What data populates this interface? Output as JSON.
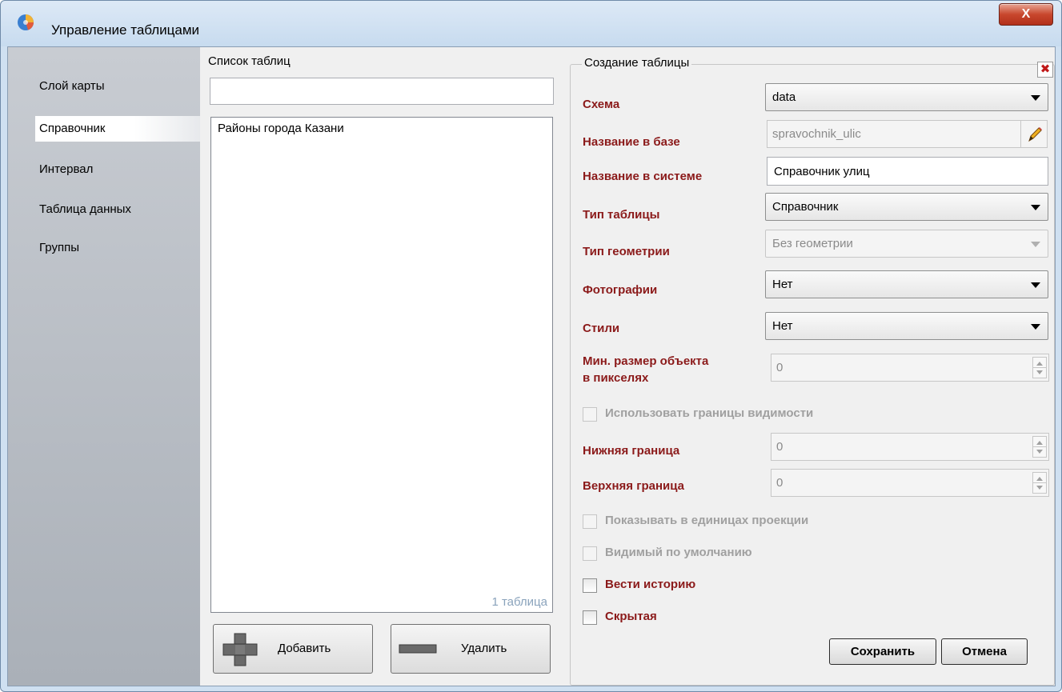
{
  "window": {
    "title": "Управление таблицами",
    "close_glyph": "X"
  },
  "sidebar": {
    "items": [
      {
        "label": "Слой карты"
      },
      {
        "label": "Справочник"
      },
      {
        "label": "Интервал"
      },
      {
        "label": "Таблица данных"
      },
      {
        "label": "Группы"
      }
    ],
    "selected": "Справочник"
  },
  "table_list": {
    "title": "Список таблиц",
    "search_value": "",
    "items": [
      "Районы города Казани"
    ],
    "count_label": "1 таблица",
    "add_label": "Добавить",
    "delete_label": "Удалить"
  },
  "create_table": {
    "title": "Создание таблицы",
    "close_glyph": "✖",
    "schema": {
      "label": "Схема",
      "value": "data"
    },
    "db_name": {
      "label": "Название в базе",
      "value": "spravochnik_ulic"
    },
    "system_name": {
      "label": "Название в системе",
      "value": "Справочник улиц"
    },
    "table_type": {
      "label": "Тип таблицы",
      "value": "Справочник"
    },
    "geometry_type": {
      "label": "Тип геометрии",
      "value": "Без геометрии"
    },
    "photos": {
      "label": "Фотографии",
      "value": "Нет"
    },
    "styles": {
      "label": "Стили",
      "value": "Нет"
    },
    "min_size": {
      "label_line1": "Мин. размер объекта",
      "label_line2": "в пикселях",
      "value": "0"
    },
    "use_visibility": {
      "label": "Использовать границы видимости",
      "checked": false
    },
    "lower_bound": {
      "label": "Нижняя граница",
      "value": "0"
    },
    "upper_bound": {
      "label": "Верхняя граница",
      "value": "0"
    },
    "projection_units": {
      "label": "Показывать в единицах проекции",
      "checked": false
    },
    "visible_default": {
      "label": "Видимый по умолчанию",
      "checked": false
    },
    "keep_history": {
      "label": "Вести историю",
      "checked": false
    },
    "hidden": {
      "label": "Скрытая",
      "checked": false
    },
    "save_label": "Сохранить",
    "cancel_label": "Отмена"
  },
  "colors": {
    "label_accent": "#8b1a1a",
    "disabled_text": "#a0a0a0",
    "titlebar": "#cfe0f1"
  }
}
